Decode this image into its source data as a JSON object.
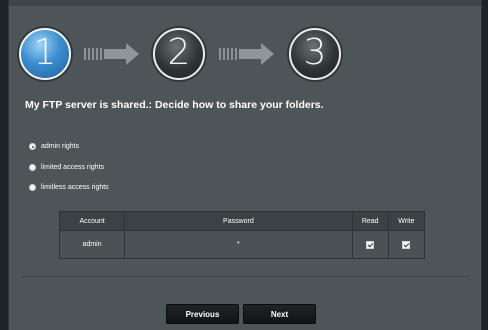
{
  "steps": [
    {
      "label": "1",
      "active": true
    },
    {
      "label": "2",
      "active": false
    },
    {
      "label": "3",
      "active": false
    }
  ],
  "page_title": "My FTP server is shared.: Decide how to share your folders.",
  "share_options": [
    {
      "label": "admin rights",
      "checked": true
    },
    {
      "label": "limited access rights",
      "checked": false
    },
    {
      "label": "limitless access rights",
      "checked": false
    }
  ],
  "accounts_table": {
    "headers": [
      "Account",
      "Password",
      "Read",
      "Write"
    ],
    "rows": [
      {
        "account": "admin",
        "password": "*",
        "read": true,
        "write": true
      }
    ]
  },
  "buttons": {
    "previous": "Previous",
    "next": "Next"
  }
}
